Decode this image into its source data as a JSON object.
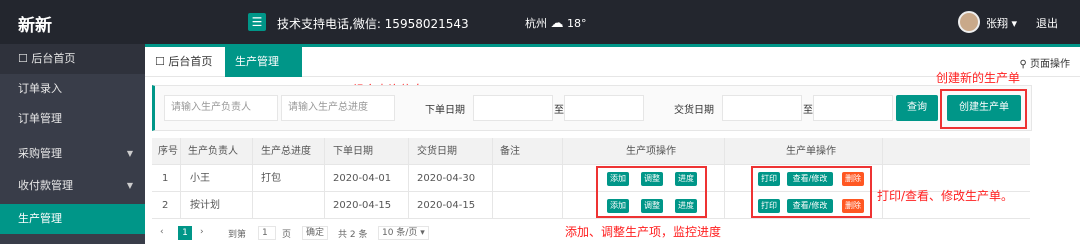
{
  "header": {
    "logo": "新新",
    "menu_toggle": "☰",
    "support": "技术支持电话,微信: 15958021543",
    "weather": {
      "city": "杭州",
      "temp": "18°"
    },
    "user": "张翔 ▾",
    "logout": "退出"
  },
  "sidebar": {
    "items": [
      {
        "label": "☐ 后台首页"
      },
      {
        "label": "订单录入"
      },
      {
        "label": "订单管理"
      },
      {
        "label": "采购管理",
        "arrow": "▼"
      },
      {
        "label": "收付款管理",
        "arrow": "▼"
      },
      {
        "label": "生产管理"
      }
    ]
  },
  "tabs": {
    "home": "☐ 后台首页",
    "active": "生产管理",
    "close": "×",
    "page_ops": "⚲ 页面操作"
  },
  "annotations": {
    "query": "组合查询信息",
    "create": "创建新的生产单",
    "print": "打印/查看、修改生产单。",
    "item_ops": "添加、调整生产项，监控进度"
  },
  "search": {
    "owner_placeholder": "请输入生产负责人",
    "progress_placeholder": "请输入生产总进度",
    "order_date_label": "下单日期",
    "to1": "至",
    "delivery_date_label": "交货日期",
    "to2": "至",
    "query_btn": "查询",
    "create_btn": "创建生产单"
  },
  "table": {
    "headers": [
      "序号",
      "生产负责人",
      "生产总进度",
      "下单日期",
      "交货日期",
      "备注",
      "生产项操作",
      "生产单操作"
    ],
    "rows": [
      {
        "no": "1",
        "owner": "小王",
        "progress": "打包",
        "order_date": "2020-04-01",
        "delivery_date": "2020-04-30",
        "remark": ""
      },
      {
        "no": "2",
        "owner": "按计划",
        "progress": "",
        "order_date": "2020-04-15",
        "delivery_date": "2020-04-15",
        "remark": ""
      }
    ],
    "item_ops": [
      "添加",
      "调整",
      "进度"
    ],
    "order_ops": [
      "打印",
      "查看/修改",
      "删除"
    ]
  },
  "pager": {
    "prev": "‹",
    "current": "1",
    "next": "›",
    "goto": "到第",
    "page_input": "1",
    "page_unit": "页",
    "confirm": "确定",
    "total": "共 2 条",
    "per_page": "10 条/页 ▾"
  },
  "colors": {
    "primary": "#009688",
    "header_bg": "#23262e",
    "sidebar_bg": "#393d49",
    "danger": "#ff5722",
    "annotation": "#ff2020"
  }
}
